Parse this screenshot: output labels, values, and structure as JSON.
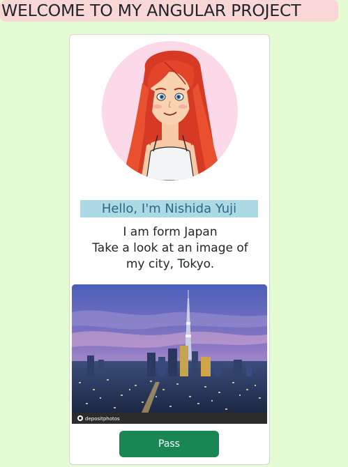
{
  "header": {
    "title": "WELCOME TO MY ANGULAR PROJECT"
  },
  "profile": {
    "greeting": "Hello, I'm Nishida Yuji",
    "intro_lines": [
      "I am form Japan",
      "Take a look at an image of",
      "my city, Tokyo."
    ],
    "avatar_icon": "cartoon-girl-avatar",
    "city_image": {
      "watermark_brand": "depositphotos"
    },
    "pass_button": "Pass"
  },
  "colors": {
    "page_background": "#e5fbd3",
    "title_background": "#f8d7d6",
    "greeting_background": "#add8e6",
    "greeting_text": "#2a6b83",
    "button_background": "#198754",
    "avatar_background": "#fcd9e8"
  }
}
